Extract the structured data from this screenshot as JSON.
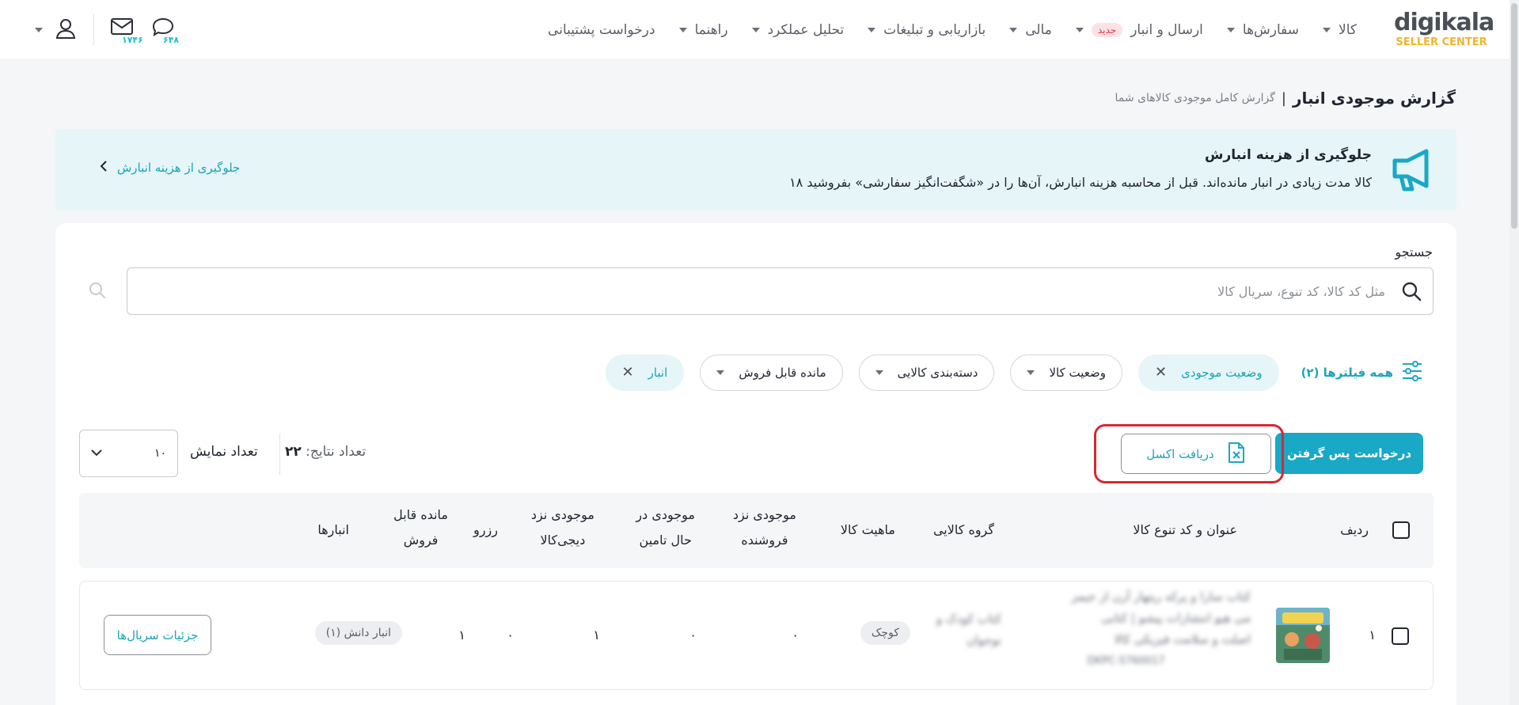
{
  "nav": {
    "logo_main": "digikala",
    "logo_sub": "SELLER CENTER",
    "items": [
      {
        "label": "کالا"
      },
      {
        "label": "سفارش‌ها"
      },
      {
        "label": "ارسال و انبار",
        "badge": "جدید"
      },
      {
        "label": "مالی"
      },
      {
        "label": "بازاریابی و تبلیغات"
      },
      {
        "label": "تحلیل عملکرد"
      },
      {
        "label": "راهنما"
      },
      {
        "label": "درخواست پشتیبانی"
      }
    ],
    "messages_count": "۱۷۴۶",
    "notifications_count": "۶۴۸"
  },
  "page": {
    "title": "گزارش موجودی انبار",
    "separator": "|",
    "subtitle": "گزارش کامل موجودی کالاهای شما"
  },
  "banner": {
    "title": "جلوگیری از هزینه انبارش",
    "text": "۱۸ کالا مدت زیادی در انبار مانده‌اند. قبل از محاسبه هزینه انبارش، آن‌ها را در «شگفت‌انگیز سفارشی» بفروشید",
    "link": "جلوگیری از هزینه انبارش"
  },
  "search": {
    "label": "جستجو",
    "placeholder": "مثل کد کالا، کد تنوع، سریال کالا"
  },
  "filters": {
    "all_label": "همه فیلترها (۲)",
    "chips": [
      {
        "label": "وضعیت موجودی",
        "active": true
      },
      {
        "label": "وضعیت کالا",
        "active": false
      },
      {
        "label": "دسته‌بندی کالایی",
        "active": false
      },
      {
        "label": "مانده قابل فروش",
        "active": false
      },
      {
        "label": "انبار",
        "active": true
      }
    ]
  },
  "actions": {
    "return_request": "درخواست پس گرفتن",
    "excel_download": "دریافت اکسل",
    "results_label": "تعداد نتایج:",
    "results_count": "۲۲",
    "page_size_label": "تعداد نمایش",
    "page_size_value": "۱۰"
  },
  "table": {
    "headers": {
      "row": "ردیف",
      "title": "عنوان و کد تنوع کالا",
      "group": "گروه کالایی",
      "nature": "ماهیت کالا",
      "seller_stock_1": "موجودی نزد",
      "seller_stock_2": "فروشنده",
      "supply_stock_1": "موجودی در",
      "supply_stock_2": "حال تامین",
      "dk_stock_1": "موجودی نزد",
      "dk_stock_2": "دیجی‌کالا",
      "reserve": "رزرو",
      "sellable_1": "مانده قابل",
      "sellable_2": "فروش",
      "warehouses": "انبارها"
    },
    "rows": [
      {
        "index": "۱",
        "title_line1": "کتاب سارا و پرکه ریتهار آرن از جیمز",
        "title_line2": "می هیو انتشارات پیشو | کتابی",
        "title_line3": "اصلت و سلامت فیزیکی کالا",
        "variant_code": "DKPC-5760017",
        "group_line1": "کتاب کودک و",
        "group_line2": "نوجوان",
        "nature": "کوچک",
        "seller_stock": "۰",
        "supply_stock": "۰",
        "dk_stock": "۱",
        "reserve": "۰",
        "sellable": "۱",
        "warehouse": "انبار دانش (۱)",
        "serials_button": "جزئیات سریال‌ها"
      }
    ]
  },
  "colors": {
    "accent": "#19a8c5",
    "banner_bg": "#e6f5f8",
    "highlight": "#d62834",
    "logo_sub": "#f0b429"
  }
}
